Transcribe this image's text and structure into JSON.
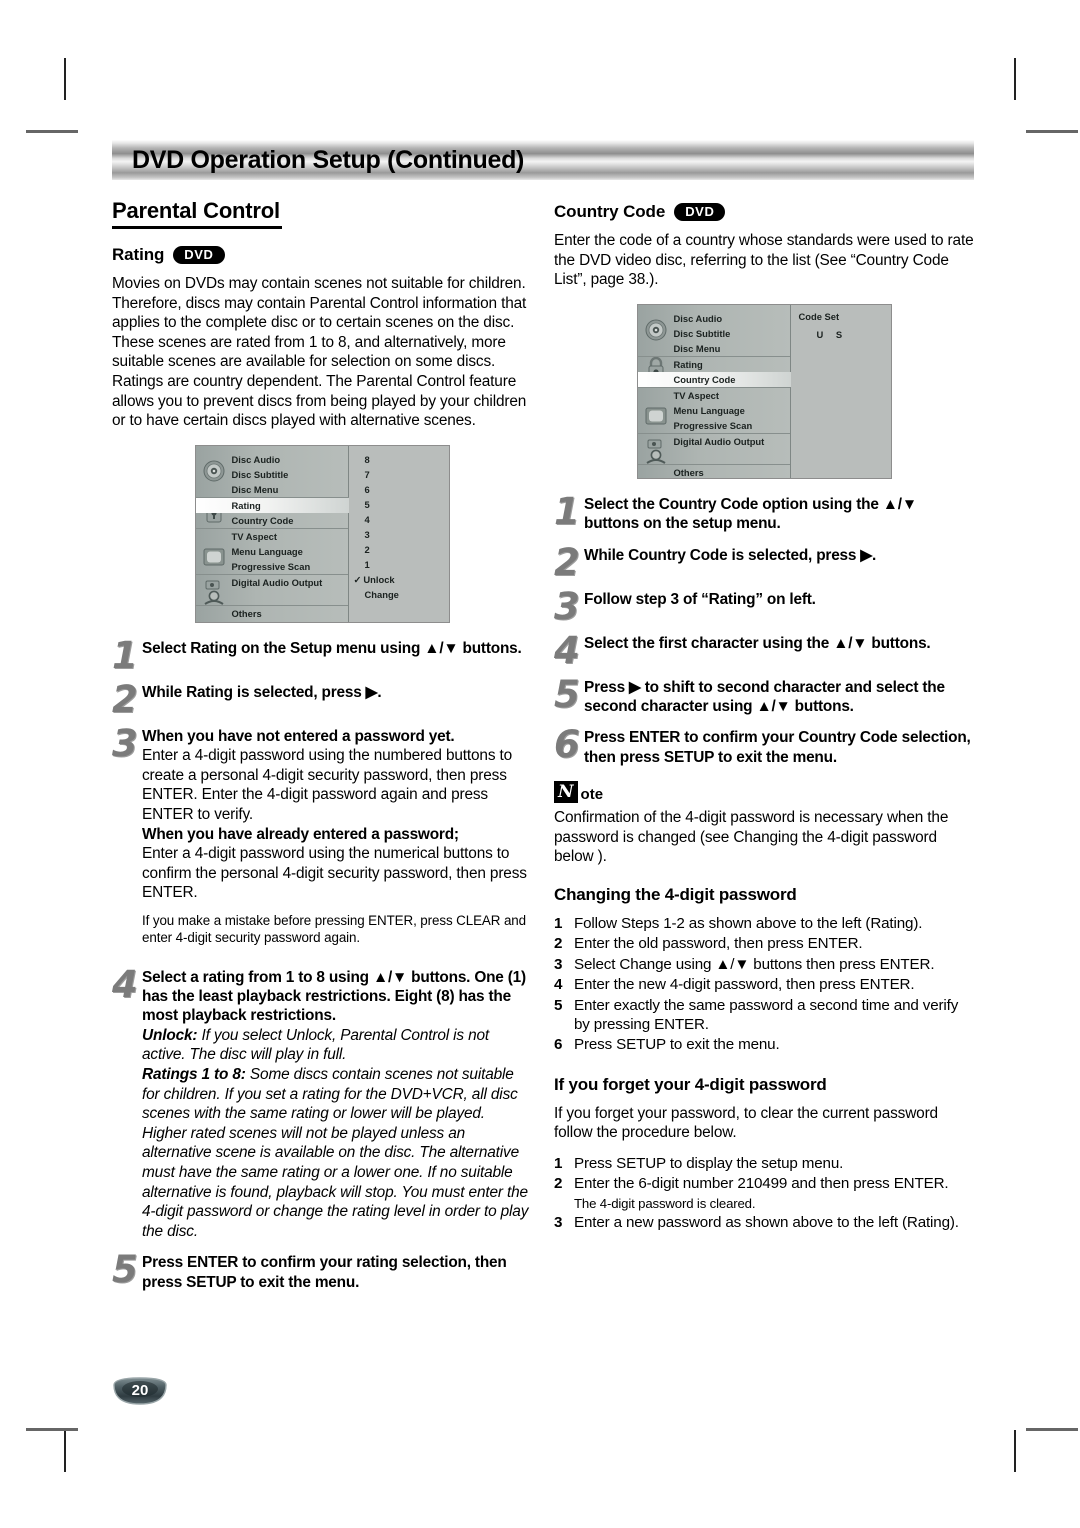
{
  "header": {
    "title": "DVD Operation Setup (Continued)"
  },
  "page_number": "20",
  "left_column": {
    "section_title": "Parental Control",
    "rating": {
      "heading": "Rating",
      "badge": "DVD",
      "intro": "Movies on DVDs may contain scenes not suitable for children. Therefore, discs may contain Parental Control information that applies to the complete disc or to certain scenes on the disc. These scenes are rated from 1 to 8, and alternatively, more suitable scenes are available for selection on some discs. Ratings are country dependent. The Parental Control feature allows you to prevent discs from being played by your children or to have certain discs played with alternative scenes.",
      "steps": [
        {
          "num": "1",
          "lead": "Select Rating on the Setup menu using ▲/▼ buttons.",
          "cont": ""
        },
        {
          "num": "2",
          "lead": "While Rating is selected, press ▶.",
          "cont": ""
        },
        {
          "num": "3",
          "lead": "When you have not entered a password yet.",
          "cont": "Enter a 4-digit password using the numbered buttons to create a personal 4-digit security password, then press ENTER. Enter the 4-digit password again and press ENTER to verify.",
          "lead2": "When you have already entered a password;",
          "cont2": "Enter a 4-digit password using the numerical buttons to confirm the personal 4-digit security password, then press ENTER.",
          "note": "If you make a mistake before pressing ENTER, press CLEAR and enter 4-digit security password again."
        },
        {
          "num": "4",
          "lead": "Select a rating from 1 to 8 using ▲/▼ buttons. One (1) has the least playback restrictions. Eight (8) has the most playback restrictions.",
          "unlock_label": "Unlock:",
          "unlock_text": " If you select Unlock, Parental Control is not active. The disc will play in full.",
          "ratings_label": "Ratings 1 to 8:",
          "ratings_text": " Some discs contain scenes not suitable for children. If you set a rating for the DVD+VCR, all disc scenes with the same rating or lower will be played. Higher rated scenes will not be played unless an alternative scene is available on the disc. The alternative must have the same rating or a lower one. If no suitable alternative is found, playback will stop. You must enter the 4-digit password or change the rating level in order to play the disc."
        },
        {
          "num": "5",
          "lead": "Press ENTER to confirm your rating selection, then press SETUP to exit the menu.",
          "cont": ""
        }
      ]
    },
    "osd": {
      "menu_items": [
        "Disc Audio",
        "Disc Subtitle",
        "Disc Menu",
        "Rating",
        "Country Code",
        "TV Aspect",
        "Menu Language",
        "Progressive Scan",
        "Digital Audio Output",
        "Others"
      ],
      "selected": "Rating",
      "values": [
        "8",
        "7",
        "6",
        "5",
        "4",
        "3",
        "2",
        "1",
        "Unlock",
        "Change"
      ],
      "checked_value": "Unlock",
      "check_glyph": "✓",
      "icons": [
        "disc-icon",
        "lock-icon",
        "tv-icon",
        "audio-output-icon"
      ]
    }
  },
  "right_column": {
    "country_code": {
      "heading": "Country Code",
      "badge": "DVD",
      "intro": "Enter the code of a country whose standards were used to rate the DVD video disc, referring to the list (See “Country Code List”, page 38.).",
      "steps": [
        {
          "num": "1",
          "lead": "Select the Country Code option using the ▲/▼ buttons on the setup menu."
        },
        {
          "num": "2",
          "lead": "While Country Code is selected, press ▶."
        },
        {
          "num": "3",
          "lead": "Follow step 3 of “Rating” on left."
        },
        {
          "num": "4",
          "lead": "Select the first character using the ▲/▼ buttons."
        },
        {
          "num": "5",
          "lead": "Press ▶ to shift to second character and select the second character using ▲/▼ buttons."
        },
        {
          "num": "6",
          "lead": "Press ENTER to confirm your Country Code selection, then press SETUP to exit the menu."
        }
      ]
    },
    "osd": {
      "menu_items": [
        "Disc Audio",
        "Disc Subtitle",
        "Disc Menu",
        "Rating",
        "Country Code",
        "TV Aspect",
        "Menu Language",
        "Progressive Scan",
        "Digital Audio Output",
        "Others"
      ],
      "selected": "Country Code",
      "code_set_label": "Code Set",
      "code_value": "U S",
      "icons": [
        "disc-icon",
        "lock-icon",
        "tv-icon",
        "audio-output-icon"
      ]
    },
    "note": {
      "glyph": "N",
      "rest": "ote",
      "text": "Confirmation of the 4-digit password is necessary when the password is changed (see Changing the 4-digit password below )."
    },
    "changing_password": {
      "heading": "Changing the 4-digit password",
      "items": [
        {
          "n": "1",
          "t": "Follow Steps 1-2 as shown above to the left (Rating)."
        },
        {
          "n": "2",
          "t": "Enter the old password, then press ENTER."
        },
        {
          "n": "3",
          "t": "Select Change using ▲/▼ buttons then press ENTER."
        },
        {
          "n": "4",
          "t": "Enter the new 4-digit password, then press ENTER."
        },
        {
          "n": "5",
          "t": "Enter exactly the same password a second time and verify by pressing ENTER."
        },
        {
          "n": "6",
          "t": "Press SETUP to exit the menu."
        }
      ]
    },
    "forgot_password": {
      "heading": "If you forget your 4-digit password",
      "intro": "If you forget your password, to clear the current password follow the procedure below.",
      "items": [
        {
          "n": "1",
          "t": "Press SETUP to display the setup menu."
        },
        {
          "n": "2",
          "t": "Enter the 6-digit number 210499 and then press ENTER.",
          "sub": "The 4-digit password is cleared."
        },
        {
          "n": "3",
          "t": "Enter a new password as shown above to the left (Rating)."
        }
      ]
    }
  },
  "colors": {
    "osd_background": "#b9bdbb",
    "osd_panel": "#aeb5b2",
    "badge_dark": "#3d4a4e",
    "text": "#000000"
  }
}
